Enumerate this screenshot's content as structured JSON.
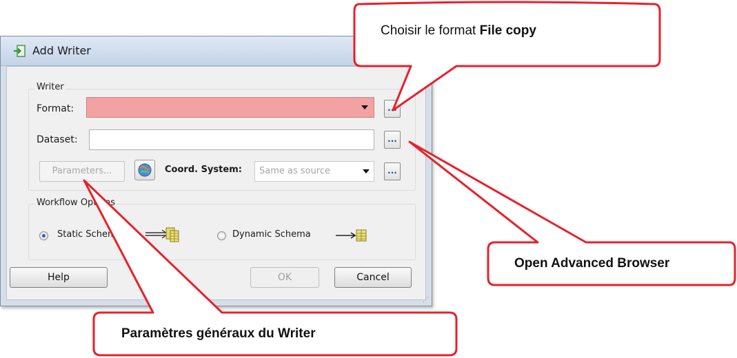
{
  "dialog": {
    "title": "Add Writer",
    "writer_group_label": "Writer",
    "format_label": "Format:",
    "format_value": "",
    "dataset_label": "Dataset:",
    "dataset_value": "",
    "ellipsis_label": "...",
    "parameters_label": "Parameters...",
    "coord_system_label": "Coord. System:",
    "coord_system_value": "Same as source",
    "workflow_group_label": "Workflow Options",
    "static_schema_label": "Static Schema",
    "dynamic_schema_label": "Dynamic Schema",
    "selected_workflow": "Static Schema",
    "help_label": "Help",
    "ok_label": "OK",
    "cancel_label": "Cancel"
  },
  "callouts": {
    "format": {
      "text": "Choisir le format ",
      "bold": "File copy"
    },
    "browser": {
      "bold": "Open Advanced Browser"
    },
    "params": {
      "bold": "Paramètres généraux du Writer"
    }
  },
  "colors": {
    "callout_border": "#e8202a",
    "format_highlight": "#f2a2a2",
    "dialog_frame": "#d6dee8"
  },
  "icons": [
    "writer-icon",
    "coord-system-icon",
    "table-icon",
    "arrow-icon"
  ]
}
